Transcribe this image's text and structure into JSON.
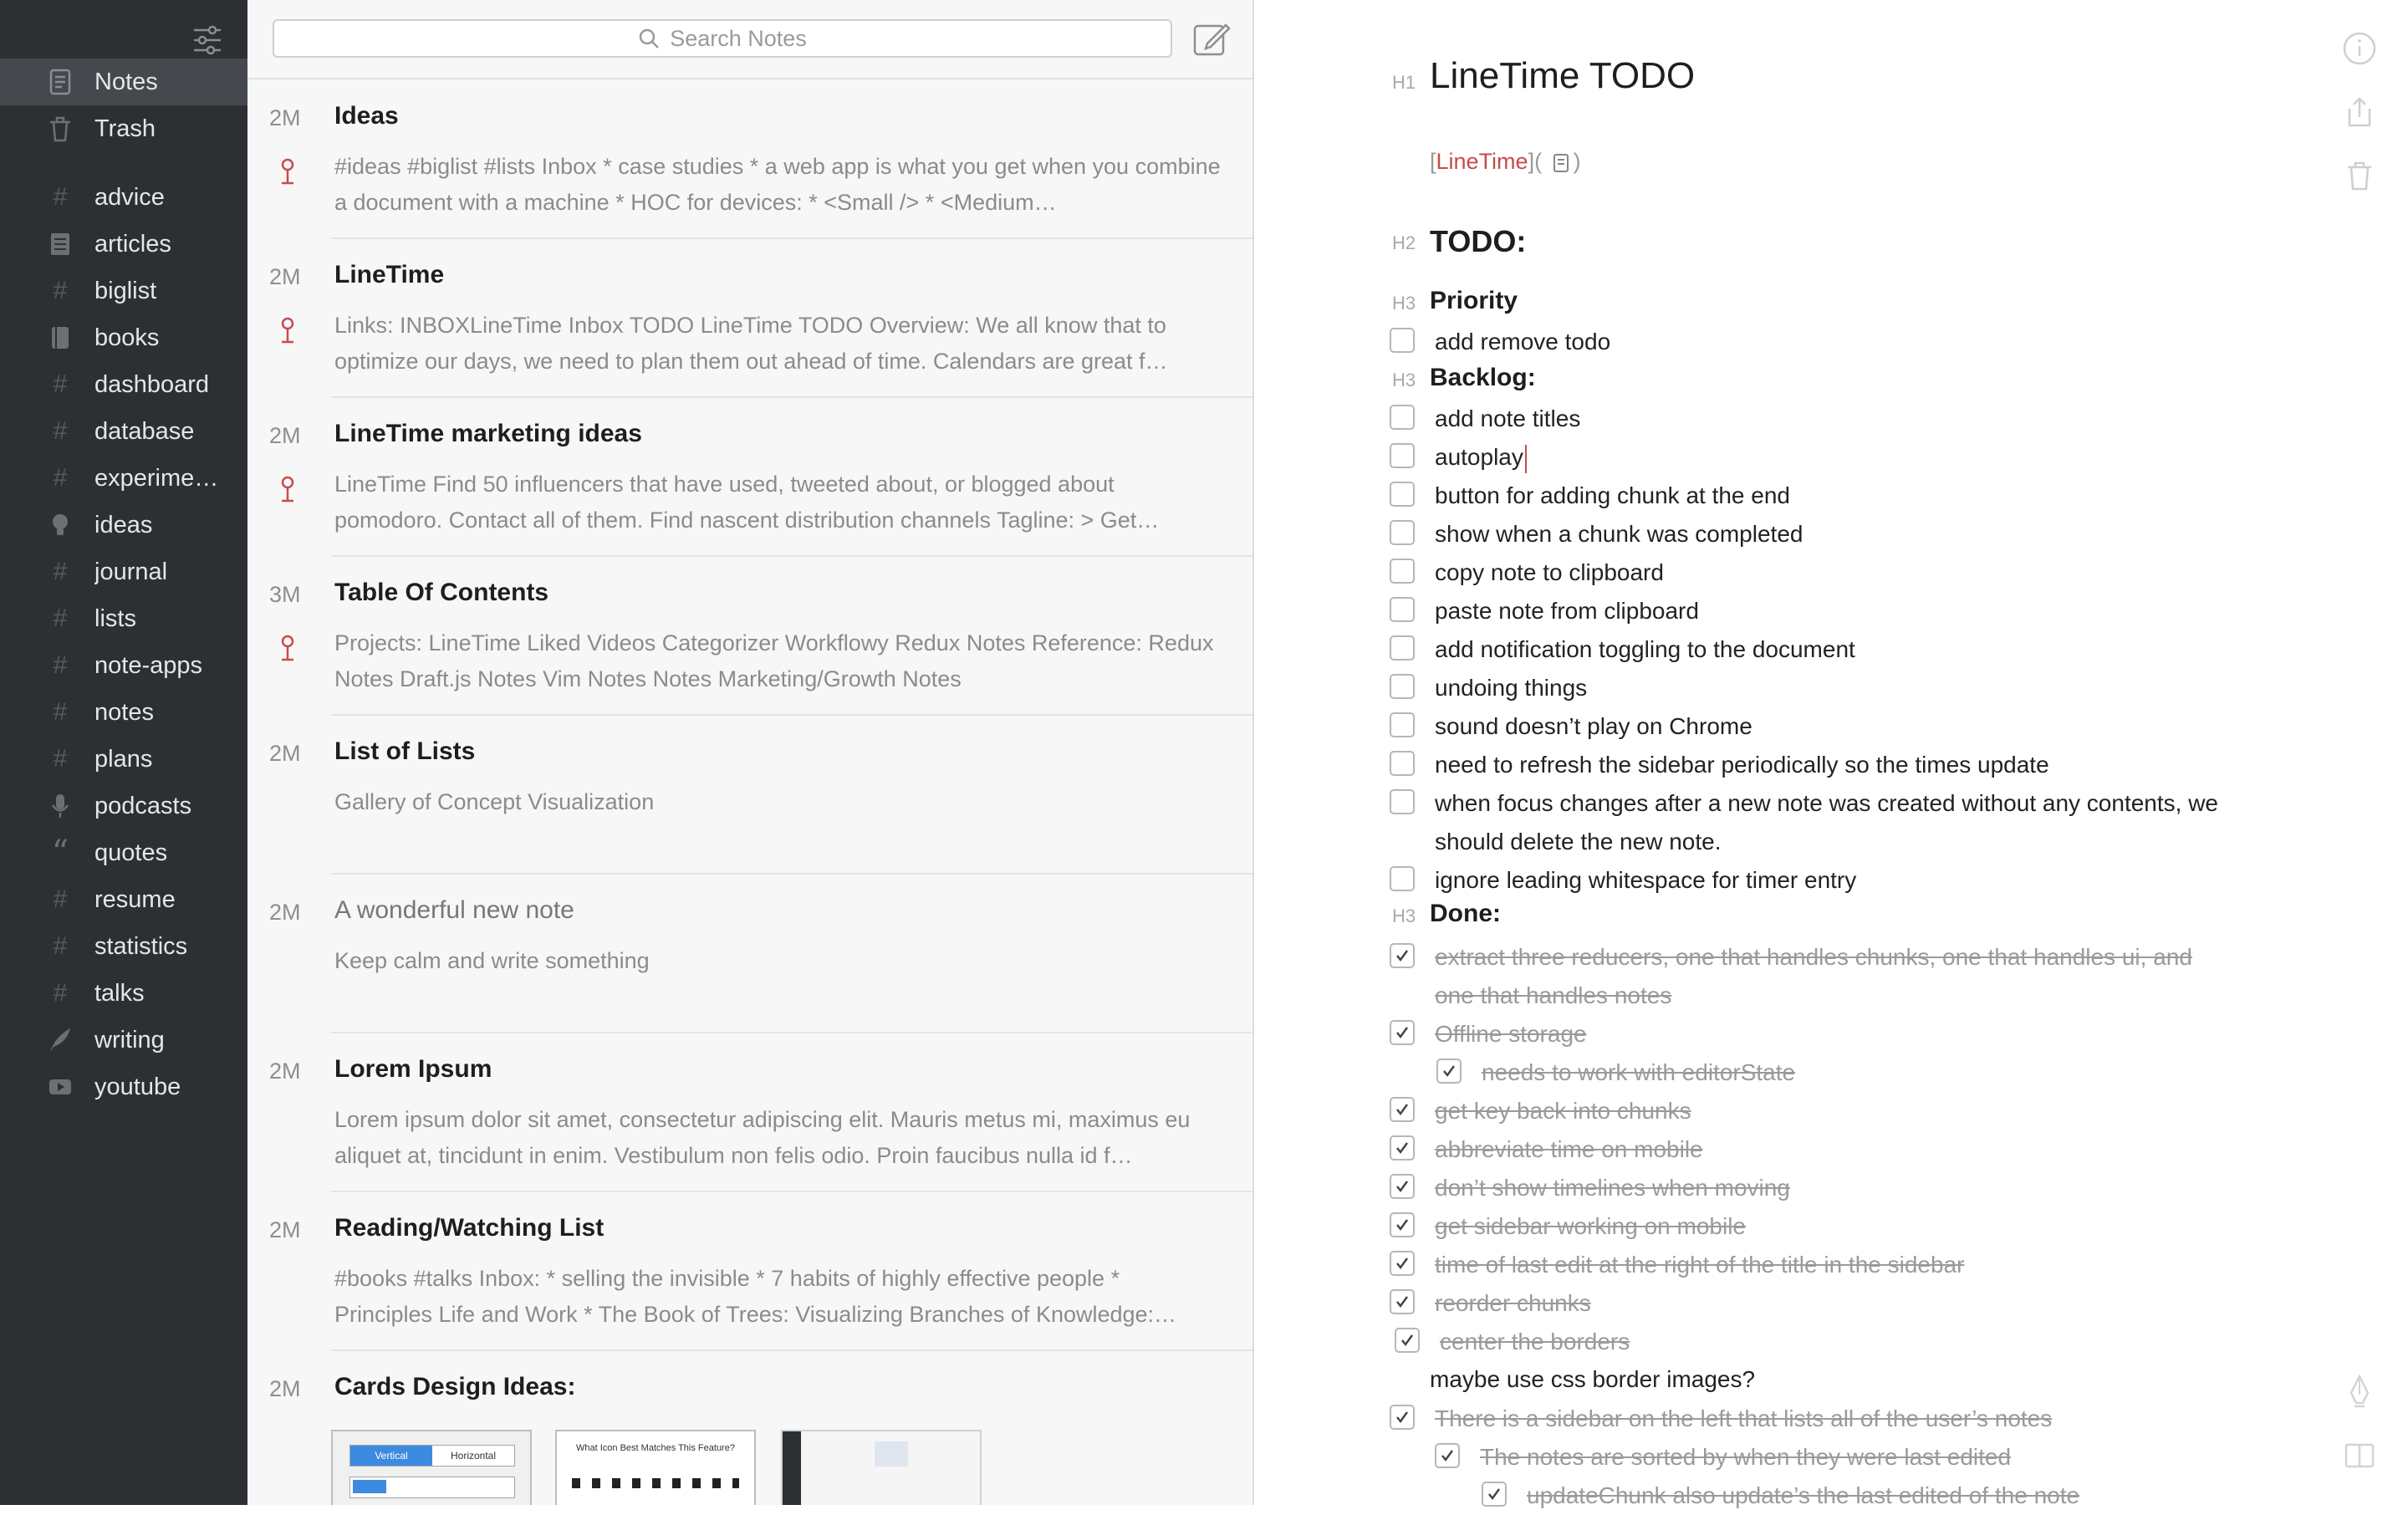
{
  "sidebar": {
    "items": [
      {
        "label": "Notes",
        "icon": "note-icon"
      },
      {
        "label": "Trash",
        "icon": "trash-icon"
      },
      {
        "label": "advice",
        "icon": "tag-icon"
      },
      {
        "label": "articles",
        "icon": "article-icon"
      },
      {
        "label": "biglist",
        "icon": "tag-icon"
      },
      {
        "label": "books",
        "icon": "book-icon"
      },
      {
        "label": "dashboard",
        "icon": "tag-icon"
      },
      {
        "label": "database",
        "icon": "tag-icon"
      },
      {
        "label": "experime…",
        "icon": "tag-icon"
      },
      {
        "label": "ideas",
        "icon": "lightbulb-icon"
      },
      {
        "label": "journal",
        "icon": "tag-icon"
      },
      {
        "label": "lists",
        "icon": "tag-icon"
      },
      {
        "label": "note-apps",
        "icon": "tag-icon"
      },
      {
        "label": "notes",
        "icon": "tag-icon"
      },
      {
        "label": "plans",
        "icon": "tag-icon"
      },
      {
        "label": "podcasts",
        "icon": "microphone-icon"
      },
      {
        "label": "quotes",
        "icon": "quote-icon"
      },
      {
        "label": "resume",
        "icon": "tag-icon"
      },
      {
        "label": "statistics",
        "icon": "tag-icon"
      },
      {
        "label": "talks",
        "icon": "tag-icon"
      },
      {
        "label": "writing",
        "icon": "feather-icon"
      },
      {
        "label": "youtube",
        "icon": "play-icon"
      }
    ]
  },
  "search": {
    "placeholder": "Search Notes"
  },
  "notes": [
    {
      "age": "2M",
      "title": "Ideas",
      "preview": "#ideas #biglist #lists Inbox * case studies * a web app is what you get when you combine a document with a machine * HOC for devices: * <Small /> * <Medium…",
      "pinned": true
    },
    {
      "age": "2M",
      "title": "LineTime",
      "preview": "Links: INBOXLineTime Inbox TODO LineTime TODO Overview: We all know that to optimize our days, we need to plan them out ahead of time. Calendars are great f…",
      "pinned": true
    },
    {
      "age": "2M",
      "title": "LineTime marketing ideas",
      "preview": "LineTime Find 50 influencers that have used, tweeted about, or blogged about pomodoro. Contact all of them. Find nascent distribution channels Tagline: > Get…",
      "pinned": true
    },
    {
      "age": "3M",
      "title": "Table Of Contents",
      "preview": "Projects: LineTime Liked Videos Categorizer Workflowy Redux Notes Reference: Redux Notes Draft.js Notes Vim Notes Notes Marketing/Growth Notes",
      "pinned": true
    },
    {
      "age": "2M",
      "title": "List of Lists",
      "preview": "Gallery of Concept Visualization",
      "pinned": false
    },
    {
      "age": "2M",
      "title": "A wonderful new note",
      "preview": "Keep calm and write something",
      "pinned": false,
      "muted": true
    },
    {
      "age": "2M",
      "title": "Lorem Ipsum",
      "preview": "Lorem ipsum dolor sit amet, consectetur adipiscing elit. Mauris metus mi, maximus eu aliquet at, tincidunt in enim. Vestibulum non felis odio. Proin faucibus nulla id f…",
      "pinned": false
    },
    {
      "age": "2M",
      "title": "Reading/Watching List",
      "preview": "#books #talks Inbox: * selling the invisible * 7 habits of highly effective people * Principles Life and Work * The Book of Trees: Visualizing Branches of Knowledge:…",
      "pinned": false
    },
    {
      "age": "2M",
      "title": "Cards Design Ideas:",
      "preview": "",
      "pinned": false
    }
  ],
  "thumbnails": {
    "thumb1": {
      "tab_a": "Vertical",
      "tab_b": "Horizontal"
    },
    "thumb2": {
      "title": "What Icon Best Matches This Feature?"
    }
  },
  "editor": {
    "marks": {
      "h1": "H1",
      "h2": "H2",
      "h3": "H3"
    },
    "title": "LineTime TODO",
    "link_text": "LineTime",
    "link_open": "[",
    "link_mid": "](",
    "link_close": ")",
    "todo_heading": "TODO:",
    "priority_heading": "Priority",
    "backlog_heading": "Backlog:",
    "done_heading": "Done:",
    "priority_items": [
      "add remove todo"
    ],
    "backlog_items": [
      "add note titles",
      "autoplay",
      "button for adding chunk at the end",
      "show when a chunk was completed",
      "copy note to clipboard",
      "paste note from clipboard",
      "add notification toggling to the document",
      "undoing things",
      "sound doesn’t play on Chrome",
      "need to refresh the sidebar periodically so the times update",
      "when focus changes after a new note was created without any contents, we should delete the new note.",
      "ignore leading whitespace for timer entry"
    ],
    "done_items": [
      "extract three reducers, one that handles chunks, one that handles ui, and one that handles notes",
      "Offline storage",
      "needs to work with editorState",
      "get key back into chunks",
      "abbreviate time on mobile",
      "don’t show timelines when moving",
      "get sidebar working on mobile",
      "time of last edit at the right of the title in the sidebar",
      "reorder chunks",
      "center the borders",
      "There is a sidebar on the left that lists all of the user’s notes",
      "The notes are sorted by when they were last edited",
      "updateChunk also update’s the last edited of the note"
    ],
    "plain_line": "maybe use css border images?"
  },
  "colors": {
    "sidebar_bg": "#2d3033",
    "sidebar_active": "#45494d",
    "list_bg": "#f7f7f7",
    "accent_red": "#c94b4b"
  }
}
